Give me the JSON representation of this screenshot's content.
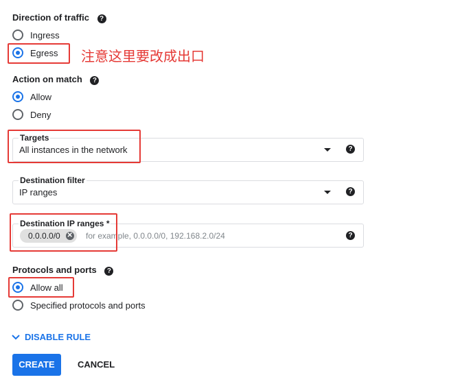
{
  "direction": {
    "title": "Direction of traffic",
    "options": [
      "Ingress",
      "Egress"
    ],
    "selected": "Egress",
    "annotation": "注意这里要改成出口"
  },
  "action": {
    "title": "Action on match",
    "options": [
      "Allow",
      "Deny"
    ],
    "selected": "Allow"
  },
  "targets": {
    "label": "Targets",
    "value": "All instances in the network"
  },
  "destination_filter": {
    "label": "Destination filter",
    "value": "IP ranges"
  },
  "destination_ip": {
    "label": "Destination IP ranges *",
    "chip": "0.0.0.0/0",
    "placeholder": "for example, 0.0.0.0/0, 192.168.2.0/24"
  },
  "protocols": {
    "title": "Protocols and ports",
    "options": [
      "Allow all",
      "Specified protocols and ports"
    ],
    "selected": "Allow all"
  },
  "disable_rule": "DISABLE RULE",
  "buttons": {
    "create": "CREATE",
    "cancel": "CANCEL"
  },
  "help_glyph": "?",
  "colors": {
    "accent": "#1a73e8",
    "annotation": "#e53935"
  }
}
